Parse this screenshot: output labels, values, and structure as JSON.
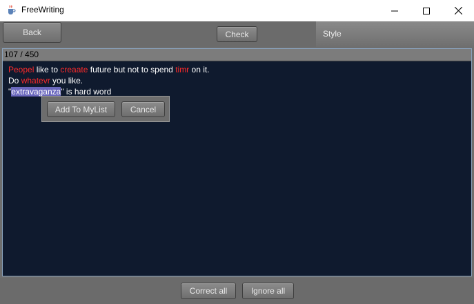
{
  "window": {
    "title": "FreeWriting",
    "icons": {
      "app": "java-cup-icon",
      "minimize": "minimize-icon",
      "maximize": "maximize-icon",
      "close": "close-icon"
    }
  },
  "toolbar": {
    "back_label": "Back",
    "check_label": "Check",
    "style_label": "Style"
  },
  "editor": {
    "counter": "107 / 450",
    "line1": {
      "w1": "Peopel",
      "t1": " like to ",
      "w2": "creaate",
      "t2": " future but not to spend ",
      "w3": "timr",
      "t3": " on it."
    },
    "line2": {
      "t1": "Do ",
      "w1": "whatevr",
      "t2": " you like."
    },
    "line3": {
      "t1": "\"",
      "sel": "extravaganza",
      "t2": "\" is hard word"
    },
    "colors": {
      "background": "#0f1a2e",
      "text": "#ffffff",
      "misspelled": "#ff2a2a",
      "selection": "#6a67bd"
    }
  },
  "popup": {
    "add_label": "Add To MyList",
    "cancel_label": "Cancel"
  },
  "bottom": {
    "correct_all_label": "Correct all",
    "ignore_all_label": "Ignore all"
  }
}
